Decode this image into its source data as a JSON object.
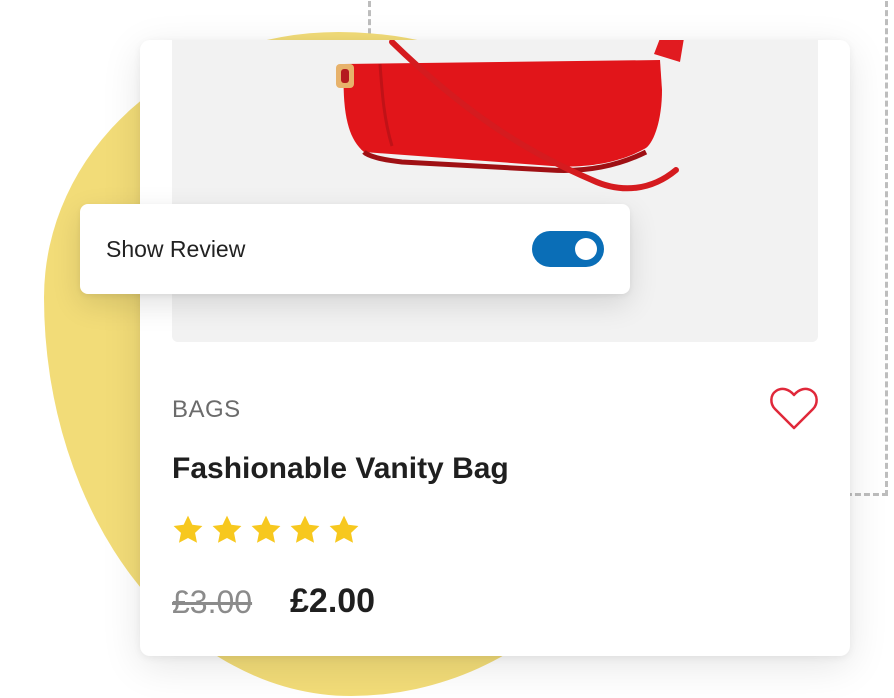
{
  "review_panel": {
    "label": "Show Review",
    "toggle_on": true
  },
  "product": {
    "category": "BAGS",
    "title": "Fashionable Vanity Bag",
    "rating": 5,
    "rating_max": 5,
    "old_price": "£3.00",
    "new_price": "£2.00",
    "image_icon": "red-handbag-photo",
    "wishlist_icon": "heart-outline-icon"
  },
  "colors": {
    "blob": "#f2dc78",
    "toggle": "#0a6eb7",
    "star": "#f7c81e",
    "heart": "#e0283a"
  }
}
